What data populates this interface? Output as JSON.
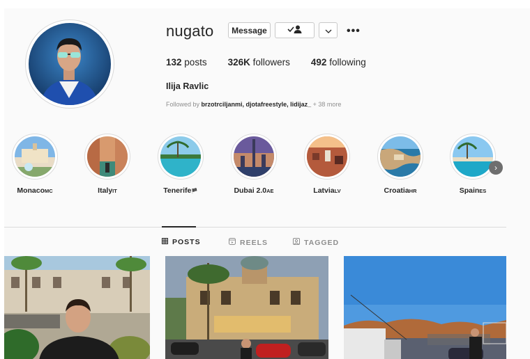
{
  "profile": {
    "username": "nugato",
    "message_label": "Message",
    "posts_count": "132",
    "posts_label": "posts",
    "followers_count": "326K",
    "followers_label": "followers",
    "following_count": "492",
    "following_label": "following",
    "full_name": "Ilija Ravlic",
    "followed_by_prefix": "Followed by",
    "followed_by_names": "brzotrciljanmi, djotafreestyle, lidijaz_",
    "followed_by_more": "+ 38 more"
  },
  "highlights": [
    {
      "name": "Monaco",
      "code": "MC"
    },
    {
      "name": "Italy",
      "code": "IT"
    },
    {
      "name": "Tenerife",
      "code": "🏴"
    },
    {
      "name": "Dubai 2.0",
      "code": "AE"
    },
    {
      "name": "Latvia",
      "code": "LV"
    },
    {
      "name": "Croatia",
      "code": "HR"
    },
    {
      "name": "Spain",
      "code": "ES"
    }
  ],
  "tabs": [
    {
      "label": "POSTS",
      "icon": "grid-icon",
      "active": true
    },
    {
      "label": "REELS",
      "icon": "reels-icon",
      "active": false
    },
    {
      "label": "TAGGED",
      "icon": "tagged-icon",
      "active": false
    }
  ],
  "colors": {
    "text": "#262626",
    "muted": "#8e8e8e",
    "border": "#dbdbdb",
    "background": "#fafafa"
  }
}
